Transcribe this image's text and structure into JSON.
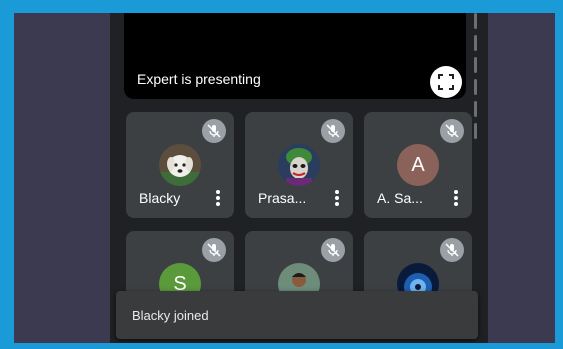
{
  "presentation": {
    "label": "Expert is presenting",
    "fullscreen_icon": "fullscreen-icon"
  },
  "participants": [
    {
      "name": "Blacky",
      "mic": "muted",
      "avatar": "photo-dog"
    },
    {
      "name": "Prasa...",
      "mic": "muted",
      "avatar": "photo-joker"
    },
    {
      "name": "A. Sa...",
      "mic": "muted",
      "avatar": "letter",
      "letter": "A",
      "avatar_color": "#8a6259"
    },
    {
      "name": "",
      "mic": "muted",
      "avatar": "letter",
      "letter": "S",
      "avatar_color": "#5a9a3a"
    },
    {
      "name": "",
      "mic": "muted",
      "avatar": "photo-person"
    },
    {
      "name": "",
      "mic": "muted",
      "avatar": "photo-blue"
    }
  ],
  "toast": {
    "message": "Blacky joined"
  },
  "colors": {
    "accent_border": "#1a9ad6",
    "tile_bg": "#3c4043",
    "meet_bg": "#202124"
  }
}
